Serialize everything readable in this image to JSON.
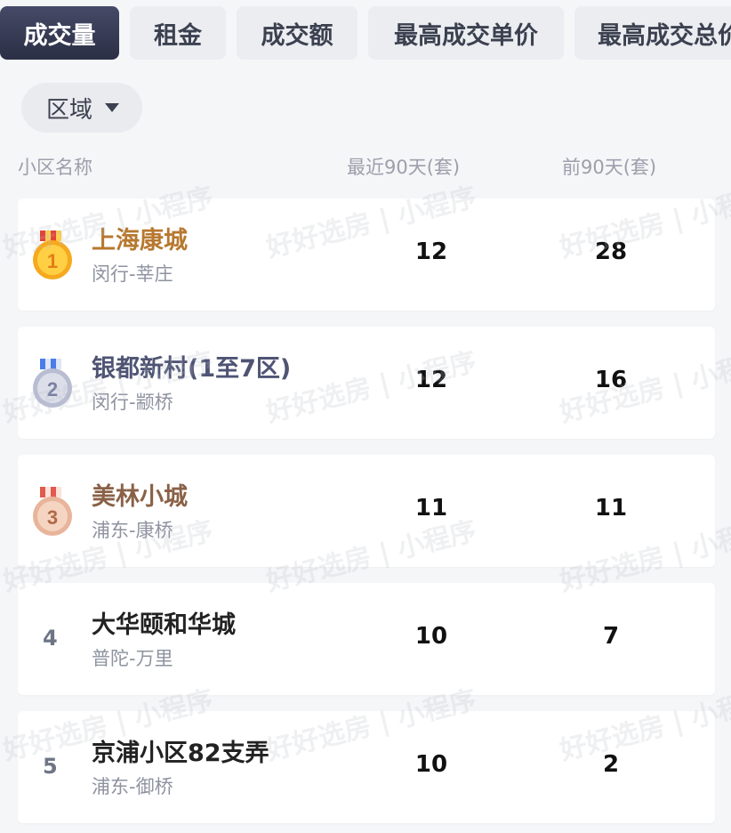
{
  "tabs": [
    {
      "label": "成交量",
      "active": true
    },
    {
      "label": "租金",
      "active": false
    },
    {
      "label": "成交额",
      "active": false
    },
    {
      "label": "最高成交单价",
      "active": false
    },
    {
      "label": "最高成交总价",
      "active": false
    }
  ],
  "filter": {
    "label": "区域"
  },
  "table": {
    "headers": {
      "name": "小区名称",
      "recent": "最近90天(套)",
      "previous": "前90天(套)"
    },
    "rows": [
      {
        "rank": "1",
        "name": "上海康城",
        "location": "闵行-莘庄",
        "recent": "12",
        "previous": "28"
      },
      {
        "rank": "2",
        "name": "银都新村(1至7区)",
        "location": "闵行-颛桥",
        "recent": "12",
        "previous": "16"
      },
      {
        "rank": "3",
        "name": "美林小城",
        "location": "浦东-康桥",
        "recent": "11",
        "previous": "11"
      },
      {
        "rank": "4",
        "name": "大华颐和华城",
        "location": "普陀-万里",
        "recent": "10",
        "previous": "7"
      },
      {
        "rank": "5",
        "name": "京浦小区82支弄",
        "location": "浦东-御桥",
        "recent": "10",
        "previous": "2"
      }
    ]
  },
  "watermark": {
    "text": "好好选房 | 小程序"
  },
  "colors": {
    "gold": "#b7782f",
    "silver": "#4f5474",
    "bronze": "#8a6147",
    "active_tab": "#2f3349"
  }
}
